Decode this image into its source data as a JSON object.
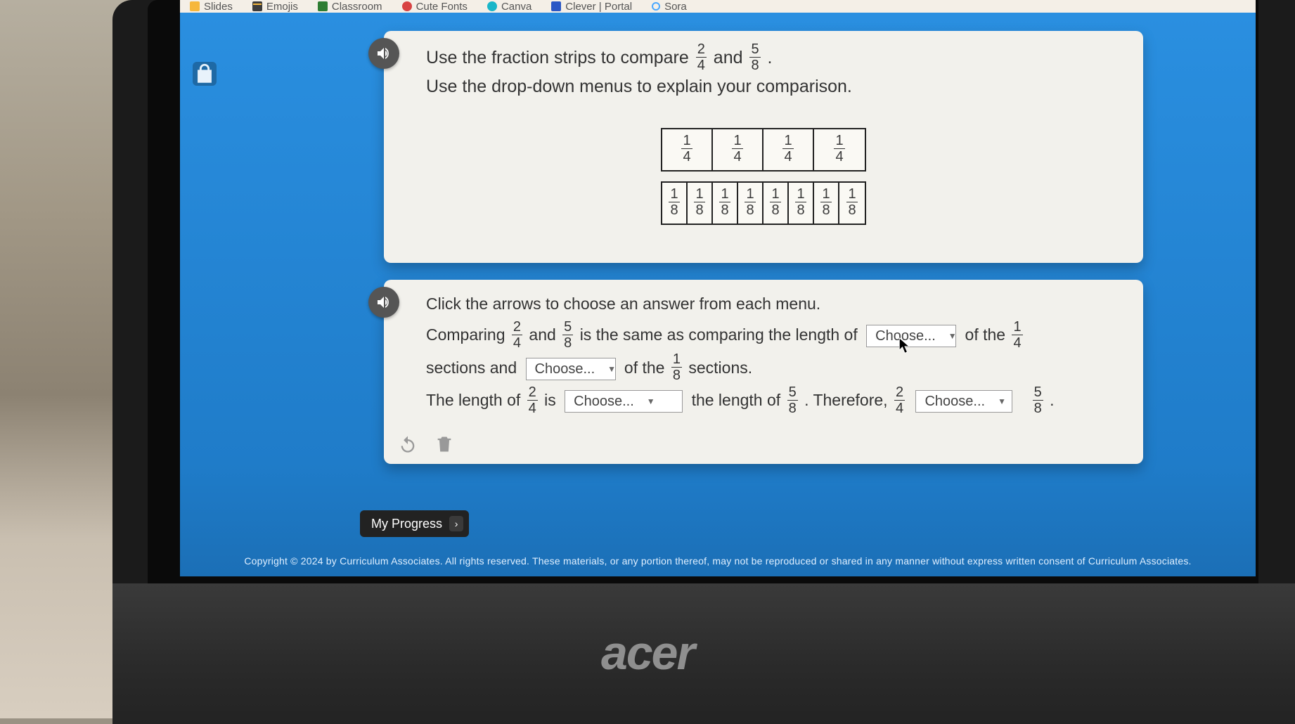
{
  "bookmarks": {
    "slides": "Slides",
    "emojis": "Emojis",
    "classroom": "Classroom",
    "cutefonts": "Cute Fonts",
    "canva": "Canva",
    "clever": "Clever | Portal",
    "sora": "Sora"
  },
  "question": {
    "line1_a": "Use the fraction strips to compare ",
    "frac1": {
      "n": "2",
      "d": "4"
    },
    "line1_b": " and ",
    "frac2": {
      "n": "5",
      "d": "8"
    },
    "line1_c": ".",
    "line2": "Use the drop-down menus to explain your comparison."
  },
  "strips": {
    "quarters": {
      "n": "1",
      "d": "4"
    },
    "eighths": {
      "n": "1",
      "d": "8"
    }
  },
  "answer_panel": {
    "instruction": "Click the arrows to choose an answer from each menu.",
    "t1": "Comparing ",
    "f1": {
      "n": "2",
      "d": "4"
    },
    "t2": " and ",
    "f2": {
      "n": "5",
      "d": "8"
    },
    "t3": " is the same as comparing the length of ",
    "dd1": "Choose...",
    "t4": " of the ",
    "f3": {
      "n": "1",
      "d": "4"
    },
    "t5": "sections and ",
    "dd2": "Choose...",
    "t6": " of the ",
    "f4": {
      "n": "1",
      "d": "8"
    },
    "t7": " sections.",
    "t8": "The length of ",
    "f5": {
      "n": "2",
      "d": "4"
    },
    "t9": " is ",
    "dd3": "Choose...",
    "t10": " the length of ",
    "f6": {
      "n": "5",
      "d": "8"
    },
    "t11": ". Therefore, ",
    "f7": {
      "n": "2",
      "d": "4"
    },
    "dd4": "Choose...",
    "f8": {
      "n": "5",
      "d": "8"
    },
    "t12": "."
  },
  "progress_label": "My Progress",
  "copyright": "Copyright © 2024 by Curriculum Associates. All rights reserved. These materials, or any portion thereof, may not be reproduced or shared in any manner without express written consent of Curriculum Associates.",
  "laptop_brand": "acer"
}
